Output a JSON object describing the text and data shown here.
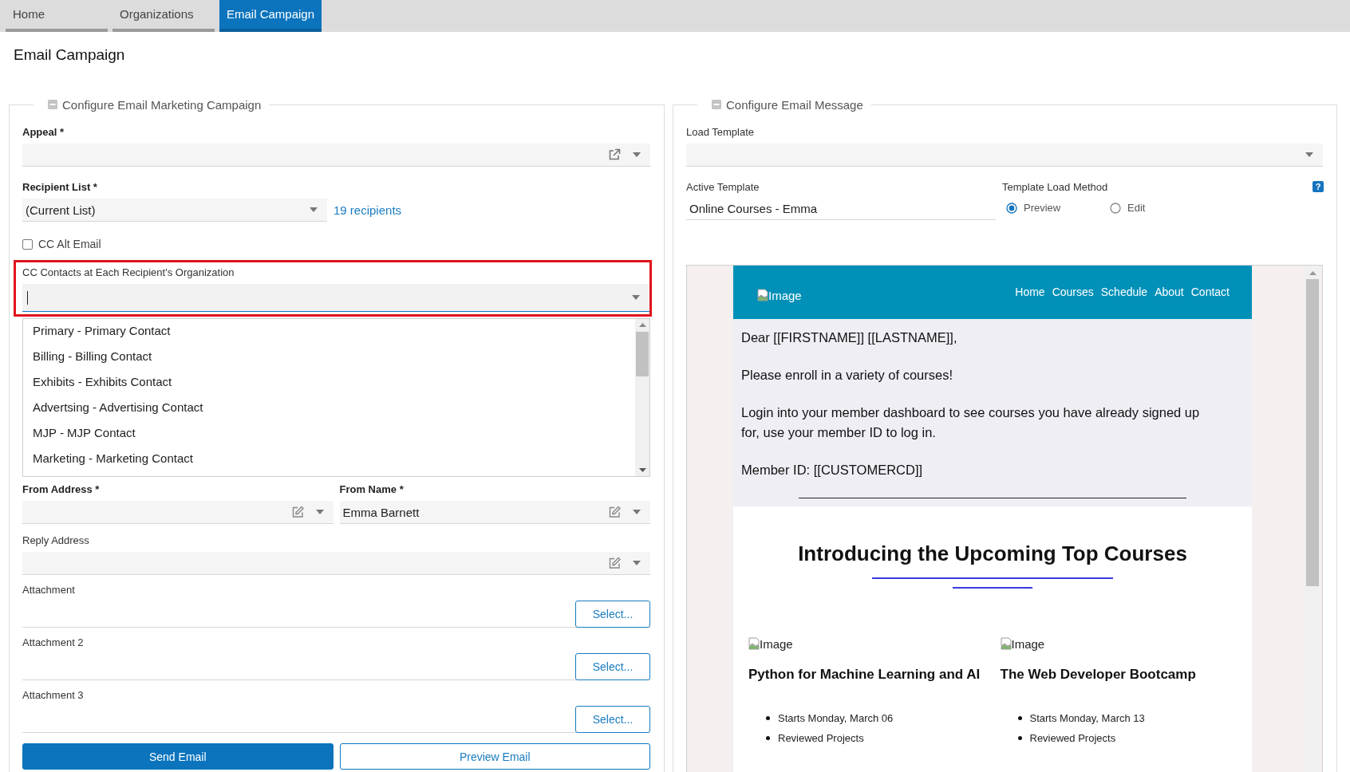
{
  "tabs": [
    {
      "label": "Home",
      "selected": false
    },
    {
      "label": "Organizations",
      "selected": false
    },
    {
      "label": "Email Campaign",
      "selected": true
    }
  ],
  "page_title": "Email Campaign",
  "campaign_panel": {
    "legend": "Configure Email Marketing Campaign",
    "appeal": {
      "label": "Appeal *",
      "required": true
    },
    "recipient_list": {
      "label": "Recipient List *",
      "required": true,
      "value": "(Current List)",
      "link": "19 recipients"
    },
    "cc_alt_email": {
      "label": "CC Alt Email",
      "checked": false
    },
    "cc_contacts": {
      "label": "CC Contacts at Each Recipient's Organization",
      "highlighted": true,
      "expanded": true,
      "options": [
        "Primary - Primary Contact",
        "Billing - Billing Contact",
        "Exhibits - Exhibits Contact",
        "Advertsing - Advertising Contact",
        "MJP - MJP Contact",
        "Marketing - Marketing Contact"
      ]
    },
    "from_address": {
      "label": "From Address *",
      "required": true
    },
    "from_name": {
      "label": "From Name *",
      "required": true,
      "value": "Emma Barnett"
    },
    "reply_address": {
      "label": "Reply Address",
      "required": false
    },
    "attachments": [
      {
        "label": "Attachment",
        "button": "Select..."
      },
      {
        "label": "Attachment 2",
        "button": "Select..."
      },
      {
        "label": "Attachment 3",
        "button": "Select..."
      }
    ],
    "buttons": [
      {
        "label": "Send Email",
        "kind": "primary"
      },
      {
        "label": "Preview Email",
        "kind": "secondary"
      }
    ]
  },
  "message_panel": {
    "legend": "Configure Email Message",
    "load_template": {
      "label": "Load Template"
    },
    "active_template": {
      "label": "Active Template",
      "value": "Online Courses - Emma"
    },
    "load_method": {
      "label": "Template Load Method",
      "help": "?",
      "options": [
        {
          "label": "Preview",
          "selected": true
        },
        {
          "label": "Edit",
          "selected": false
        }
      ]
    },
    "preview": {
      "logo_alt": "Image",
      "nav": [
        "Home",
        "Courses",
        "Schedule",
        "About",
        "Contact"
      ],
      "paragraphs": [
        "Dear [[FIRSTNAME]] [[LASTNAME]],",
        "Please enroll in a variety of courses!",
        "Login into your member dashboard to see courses you have already signed up for, use your member ID to log in.",
        "Member ID: [[CUSTOMERCD]]"
      ],
      "heading": "Introducing the Upcoming Top Courses",
      "courses": [
        {
          "image_alt": "Image",
          "title": "Python for Machine Learning and AI",
          "bullets": [
            "Starts Monday, March 06",
            "Reviewed Projects"
          ]
        },
        {
          "image_alt": "Image",
          "title": "The Web Developer Bootcamp",
          "bullets": [
            "Starts Monday, March 13",
            "Reviewed Projects"
          ]
        }
      ]
    }
  }
}
